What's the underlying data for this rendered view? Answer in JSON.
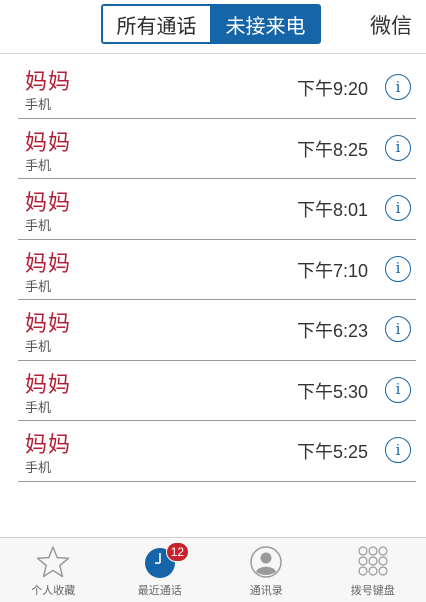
{
  "header": {
    "segment_all": "所有通话",
    "segment_missed": "未接来电",
    "wechat": "微信"
  },
  "calls": [
    {
      "name": "妈妈",
      "type": "手机",
      "time": "下午9:20"
    },
    {
      "name": "妈妈",
      "type": "手机",
      "time": "下午8:25"
    },
    {
      "name": "妈妈",
      "type": "手机",
      "time": "下午8:01"
    },
    {
      "name": "妈妈",
      "type": "手机",
      "time": "下午7:10"
    },
    {
      "name": "妈妈",
      "type": "手机",
      "time": "下午6:23"
    },
    {
      "name": "妈妈",
      "type": "手机",
      "time": "下午5:30"
    },
    {
      "name": "妈妈",
      "type": "手机",
      "time": "下午5:25"
    }
  ],
  "info_glyph": "i",
  "tabbar": {
    "favorites": "个人收藏",
    "recents": "最近通话",
    "recents_badge": "12",
    "contacts": "通讯录",
    "keypad": "拨号键盘"
  },
  "colors": {
    "accent": "#1565a8",
    "missed_name": "#b32035",
    "badge": "#c9222e"
  },
  "icons": [
    "star-icon",
    "clock-icon",
    "person-icon",
    "keypad-icon",
    "info-icon"
  ]
}
